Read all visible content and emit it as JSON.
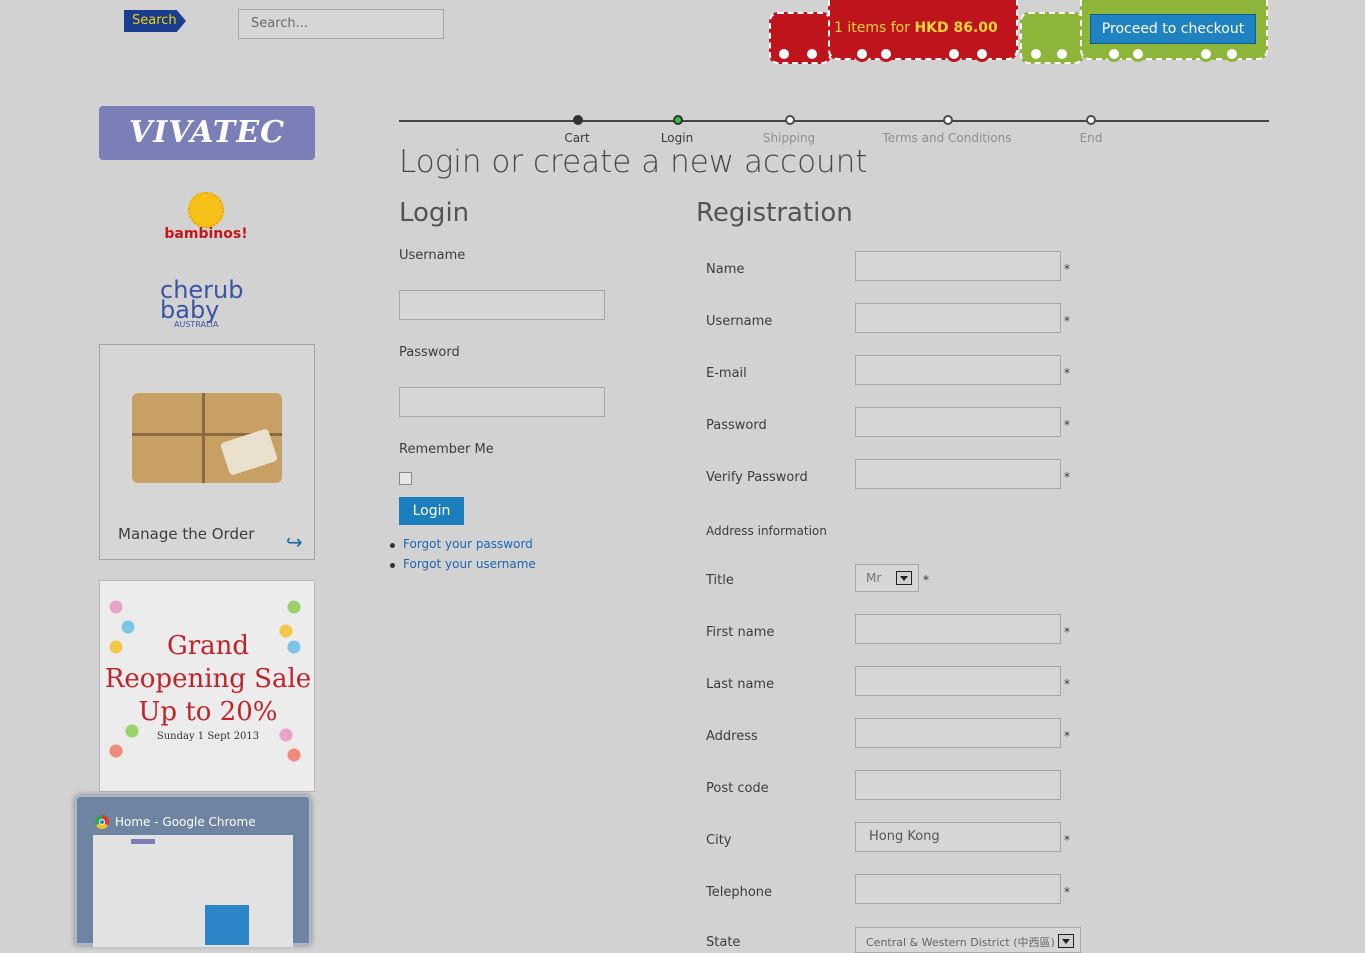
{
  "header": {
    "search_button": "Search",
    "search_placeholder": "Search...",
    "cart_prefix": "1 items for",
    "cart_total": "HKD 86.00",
    "checkout_label": "Proceed to checkout",
    "colors": {
      "cart_red": "#c0141c",
      "cart_green": "#8cb53a",
      "accent_blue": "#1b7fbe"
    }
  },
  "sidebar": {
    "vivatec_logo": "VIVATEC",
    "bambinos_logo": "bambinos!",
    "cherub_logo": "cherub baby",
    "cherub_sub": "AUSTRALIA",
    "manage_label": "Manage  the Order",
    "sale": {
      "line1": "Grand",
      "line2": "Reopening Sale",
      "line3": "Up to 20%",
      "date": "Sunday 1 Sept 2013"
    }
  },
  "taskbar_preview": {
    "title": "Home - Google Chrome"
  },
  "progress": {
    "steps": [
      {
        "label": "Cart",
        "state": "done"
      },
      {
        "label": "Login",
        "state": "current"
      },
      {
        "label": "Shipping",
        "state": "todo"
      },
      {
        "label": "Terms and Conditions",
        "state": "todo"
      },
      {
        "label": "End",
        "state": "todo"
      }
    ]
  },
  "page_title": "Login or create a new account",
  "login": {
    "title": "Login",
    "username_label": "Username",
    "password_label": "Password",
    "remember_label": "Remember Me",
    "button": "Login",
    "links": [
      "Forgot your password",
      "Forgot your username"
    ]
  },
  "registration": {
    "title": "Registration",
    "name_label": "Name",
    "username_label": "Username",
    "email_label": "E-mail",
    "password_label": "Password",
    "verify_label": "Verify Password",
    "address_info": "Address information",
    "title_label": "Title",
    "title_value": "Mr",
    "firstname_label": "First name",
    "lastname_label": "Last name",
    "address_label": "Address",
    "postcode_label": "Post code",
    "city_label": "City",
    "city_value": "Hong Kong",
    "telephone_label": "Telephone",
    "state_label": "State",
    "state_value": "Central & Western District (中西區)",
    "required_mark": "*"
  }
}
